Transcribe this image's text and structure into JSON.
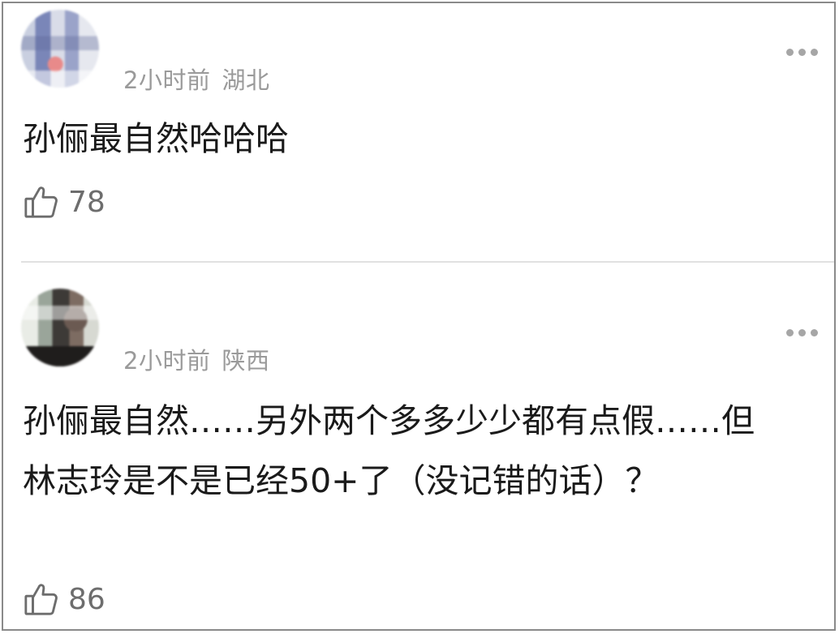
{
  "comments": [
    {
      "time": "2小时前",
      "location": "湖北",
      "text": "孙俪最自然哈哈哈",
      "likes": "78"
    },
    {
      "time": "2小时前",
      "location": "陕西",
      "text": "孙俪最自然……另外两个多多少少都有点假……但林志玲是不是已经50+了（没记错的话）？",
      "likes": "86"
    }
  ],
  "icons": {
    "like": "thumbs-up-icon",
    "more": "more-dots-icon"
  },
  "colors": {
    "meta_text": "#9a9a9a",
    "body_text": "#1a1a1a",
    "like_count": "#6d6d6d",
    "divider": "#e1e1e1"
  }
}
